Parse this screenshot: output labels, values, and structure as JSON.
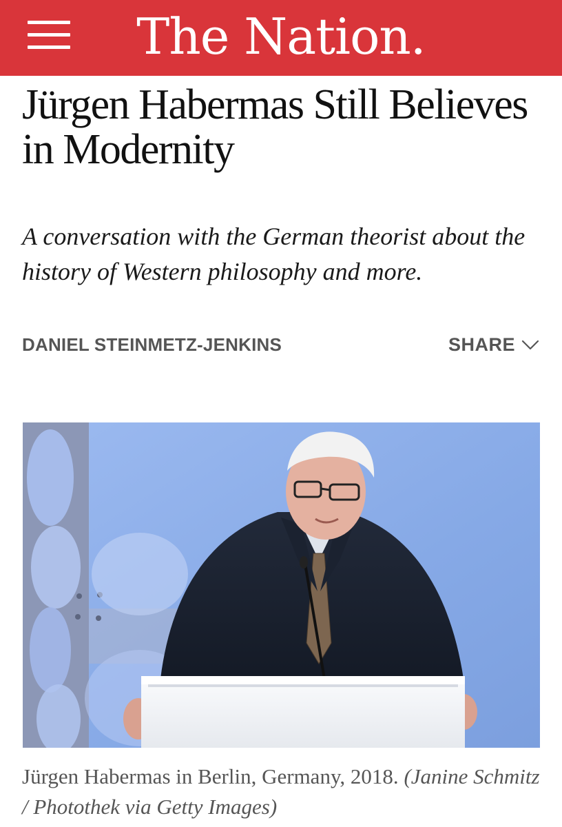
{
  "header": {
    "brand": "The Nation.",
    "menu_icon": "hamburger-menu-icon",
    "background_color": "#d9353a"
  },
  "article": {
    "headline": "Jürgen Habermas Still Believes in Modernity",
    "dek": "A conversation with the German theorist about the history of Western philosophy and more.",
    "author": "DANIEL STEINMETZ-JENKINS",
    "share_label": "SHARE",
    "share_icon": "chevron-down-icon",
    "image_caption": "Jürgen Habermas in Berlin, Germany, 2018.",
    "image_credit": "(Janine Schmitz / Photothek via Getty Images)"
  }
}
